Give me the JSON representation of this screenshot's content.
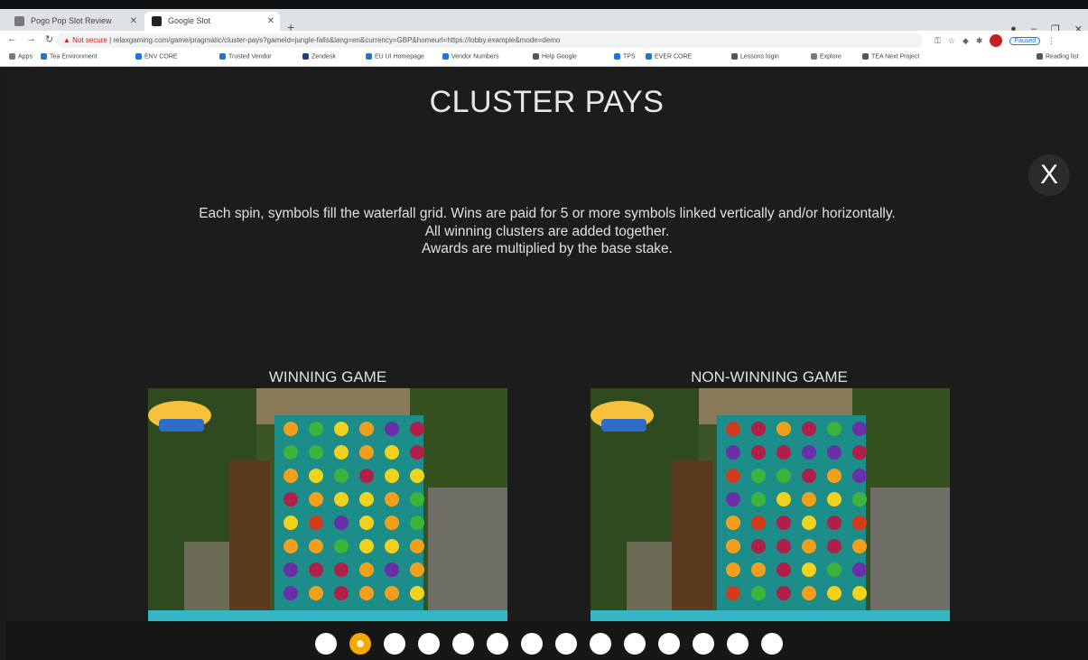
{
  "browser": {
    "tabs": [
      {
        "label": "Pogo Pop Slot Review"
      },
      {
        "label": "Google Slot"
      }
    ],
    "new_tab": "+",
    "url_warning": "Not secure",
    "url": "relaxgaming.com/game/pragmatic/cluster-pays?gameid=jungle-falls&lang=en&currency=GBP&homeurl=https://lobby.example&mode=demo",
    "paused_label": "Paused",
    "bookmarks": [
      "Apps",
      "Tea Environment",
      "ENV CORE",
      "Trusted Vendor",
      "Zendesk",
      "EU UI Homepage",
      "Vendor Numbers",
      "Help Google",
      "TPS",
      "EVER CORE",
      "Lessons login",
      "Explore",
      "TEA Next Project",
      "Reading list"
    ]
  },
  "game": {
    "title": "CLUSTER PAYS",
    "close_label": "X",
    "description": [
      "Each spin, symbols fill the waterfall grid. Wins are paid for 5 or more symbols linked vertically and/or horizontally.",
      "All winning clusters are added together.",
      "Awards are multiplied by the base stake."
    ],
    "panels": [
      {
        "label": "WINNING GAME"
      },
      {
        "label": "NON-WINNING GAME"
      }
    ],
    "pagination": {
      "total": 14,
      "active_index": 1
    }
  }
}
